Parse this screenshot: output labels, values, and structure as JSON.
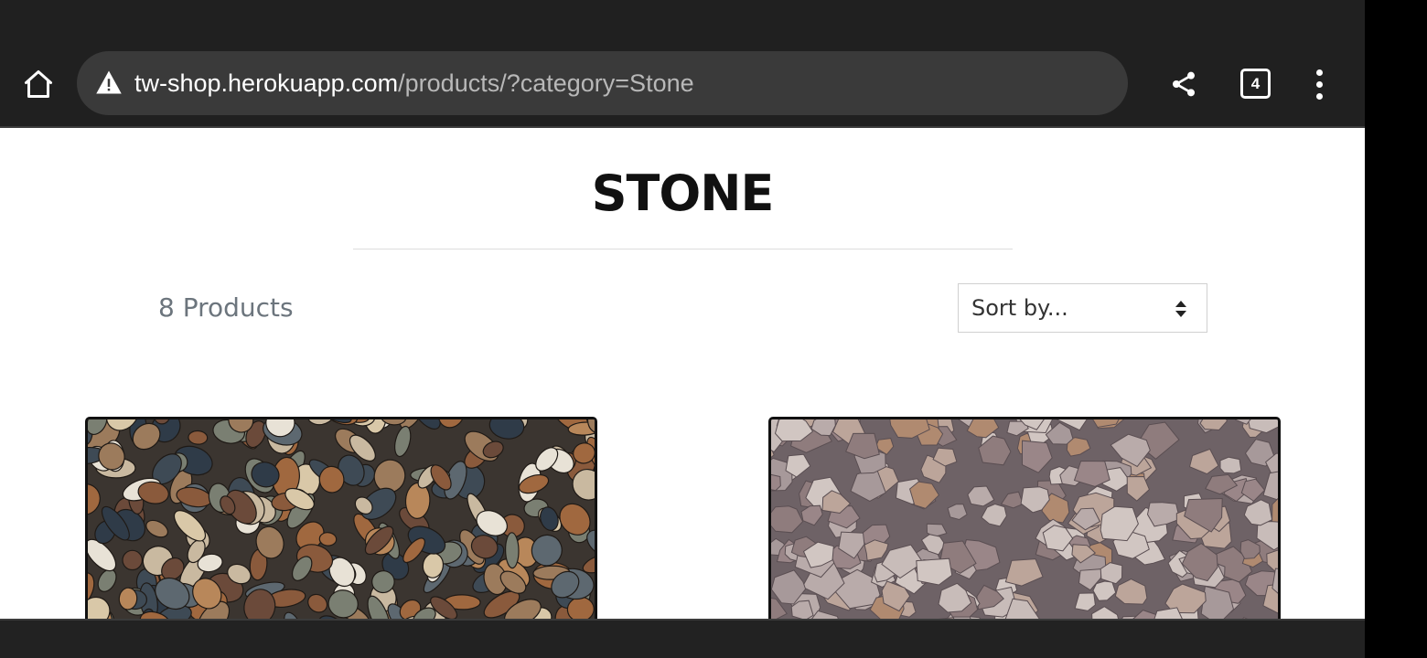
{
  "browser": {
    "url_host": "tw-shop.herokuapp.com",
    "url_path": "/products/?category=Stone",
    "tab_count": "4",
    "icons": [
      "home-icon",
      "warning-icon",
      "share-icon",
      "tabs-icon",
      "more-vert-icon"
    ]
  },
  "page": {
    "title": "STONE",
    "product_count": "8 Products",
    "sort": {
      "selected": "Sort by..."
    }
  },
  "products": [
    {
      "image": "pebbles-image"
    },
    {
      "image": "gravel-image"
    }
  ],
  "colors": {
    "toolbar_bg": "#202020",
    "url_bar_bg": "#3a3a3a",
    "count_text": "#6c757d"
  }
}
